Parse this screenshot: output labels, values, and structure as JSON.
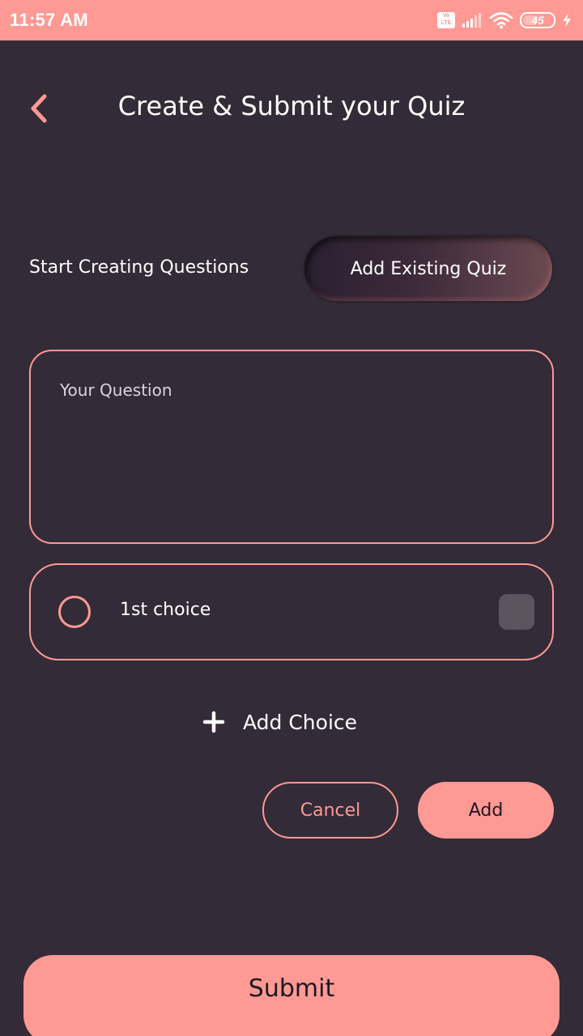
{
  "status_bar": {
    "time": "11:57 AM",
    "battery": "45",
    "icons": [
      "volte-icon",
      "signal-icon",
      "wifi-icon",
      "battery-icon",
      "charging-icon"
    ]
  },
  "header": {
    "title": "Create & Submit your Quiz",
    "back_icon": "chevron-left-icon"
  },
  "modes": {
    "start_label": "Start Creating Questions",
    "existing_label": "Add Existing Quiz"
  },
  "question": {
    "placeholder": "Your Question",
    "value": ""
  },
  "choices": [
    {
      "label": "1st choice",
      "selected": false,
      "checked": false
    }
  ],
  "add_choice": {
    "label": "Add Choice",
    "icon": "plus-icon"
  },
  "actions": {
    "cancel_label": "Cancel",
    "add_label": "Add"
  },
  "submit_label": "Submit",
  "colors": {
    "background": "#332b37",
    "accent": "#ff9994",
    "text": "#ffffff",
    "button_text": "#1c1820",
    "checkbox": "#5c5560"
  }
}
